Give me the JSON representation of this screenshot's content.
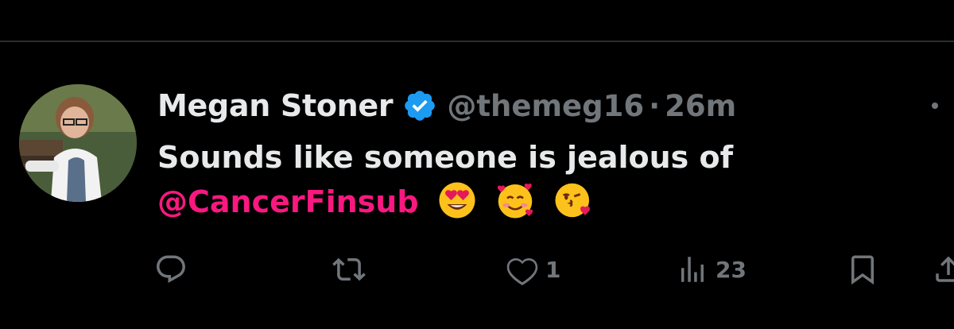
{
  "tweet": {
    "author_name": "Megan Stoner",
    "author_handle": "@themeg16",
    "separator": "·",
    "time": "26m",
    "verified": true,
    "text_line1": "Sounds like someone is jealous of",
    "mention": "@CancerFinsub",
    "emojis": [
      "heart-eyes-emoji",
      "smiling-face-with-hearts-emoji",
      "face-blowing-kiss-emoji"
    ]
  },
  "actions": {
    "reply_count": "",
    "retweet_count": "",
    "like_count": "1",
    "views_count": "23"
  },
  "colors": {
    "background": "#000000",
    "text": "#e7e9ea",
    "muted": "#71767b",
    "mention": "#f91880",
    "verified": "#1d9bf0"
  }
}
